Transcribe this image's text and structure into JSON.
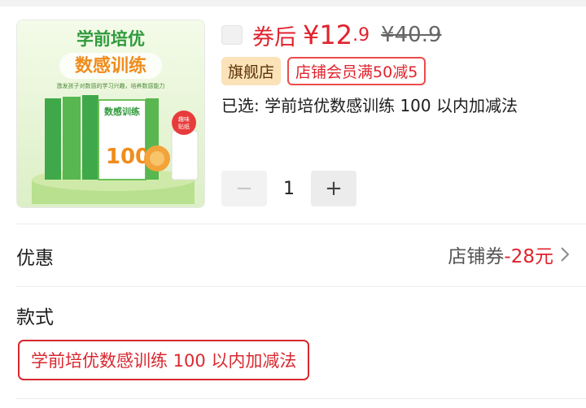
{
  "product": {
    "image": {
      "title_line1": "学前培优",
      "title_line2": "数感训练",
      "subtitle": "激发孩子对数感的学习兴趣，培养数感能力",
      "badge_line1": "趣味",
      "badge_line2": "贴纸",
      "book_title": "数感训练",
      "book_number": "100"
    },
    "price": {
      "after_coupon_label": "券后",
      "currency": "¥",
      "integer": "12",
      "decimal": ".9",
      "original": "¥40.9"
    },
    "tags": {
      "flagship": "旗舰店",
      "member": "店铺会员满50减5"
    },
    "selected_text": "已选: 学前培优数感训练 100 以内加减法",
    "quantity": {
      "minus": "−",
      "value": "1",
      "plus": "+"
    }
  },
  "offers": {
    "label": "优惠",
    "coupon_text": "店铺券",
    "coupon_amount": "-28元"
  },
  "style": {
    "label": "款式",
    "option": "学前培优数感训练 100 以内加减法"
  },
  "colors": {
    "accent_red": "#e0232c",
    "flagship_bg": "#fbe2b8",
    "thumb_green": "#7cc142"
  }
}
